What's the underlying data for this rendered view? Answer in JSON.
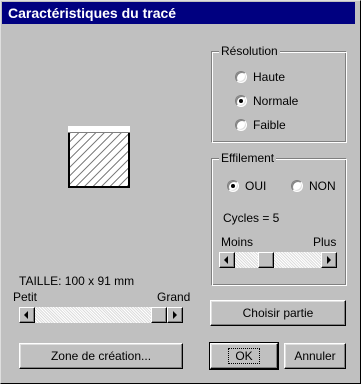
{
  "window": {
    "title": "Caractéristiques du tracé"
  },
  "resolution": {
    "label": "Résolution",
    "options": [
      {
        "label": "Haute",
        "checked": false
      },
      {
        "label": "Normale",
        "checked": true
      },
      {
        "label": "Faible",
        "checked": false
      }
    ]
  },
  "effilement": {
    "label": "Effilement",
    "oui_label": "OUI",
    "non_label": "NON",
    "oui_checked": true,
    "cycles_text": "Cycles = 5",
    "min_label": "Moins",
    "max_label": "Plus",
    "slider_value": 0.33
  },
  "size": {
    "text": "TAILLE: 100 x  91 mm",
    "min_label": "Petit",
    "max_label": "Grand",
    "slider_value": 1.0
  },
  "buttons": {
    "choose_part": "Choisir partie",
    "creation_zone": "Zone de création...",
    "ok": "OK",
    "cancel": "Annuler"
  }
}
